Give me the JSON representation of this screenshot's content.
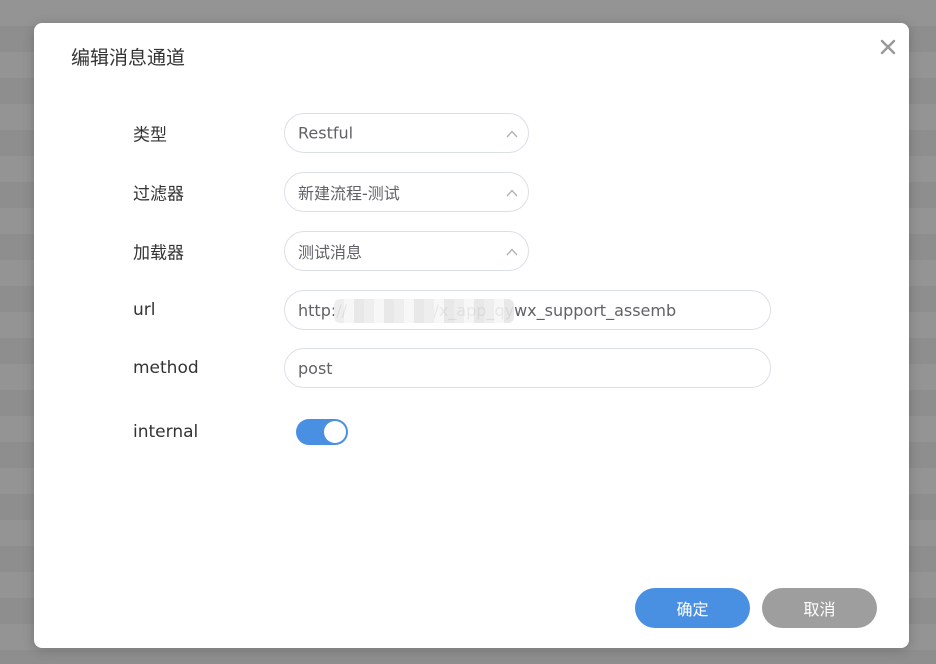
{
  "dialog": {
    "title": "编辑消息通道",
    "close_icon": "close-icon"
  },
  "form": {
    "type": {
      "label": "类型",
      "value": "Restful"
    },
    "filter": {
      "label": "过滤器",
      "value": "新建流程-测试"
    },
    "loader": {
      "label": "加载器",
      "value": "测试消息"
    },
    "url": {
      "label": "url",
      "value": "http://                 /x_app_qywx_support_assemb"
    },
    "method": {
      "label": "method",
      "value": "post"
    },
    "internal": {
      "label": "internal",
      "enabled": true
    }
  },
  "footer": {
    "confirm_label": "确定",
    "cancel_label": "取消"
  },
  "colors": {
    "primary": "#4a90e2",
    "secondary": "#9e9e9e"
  }
}
